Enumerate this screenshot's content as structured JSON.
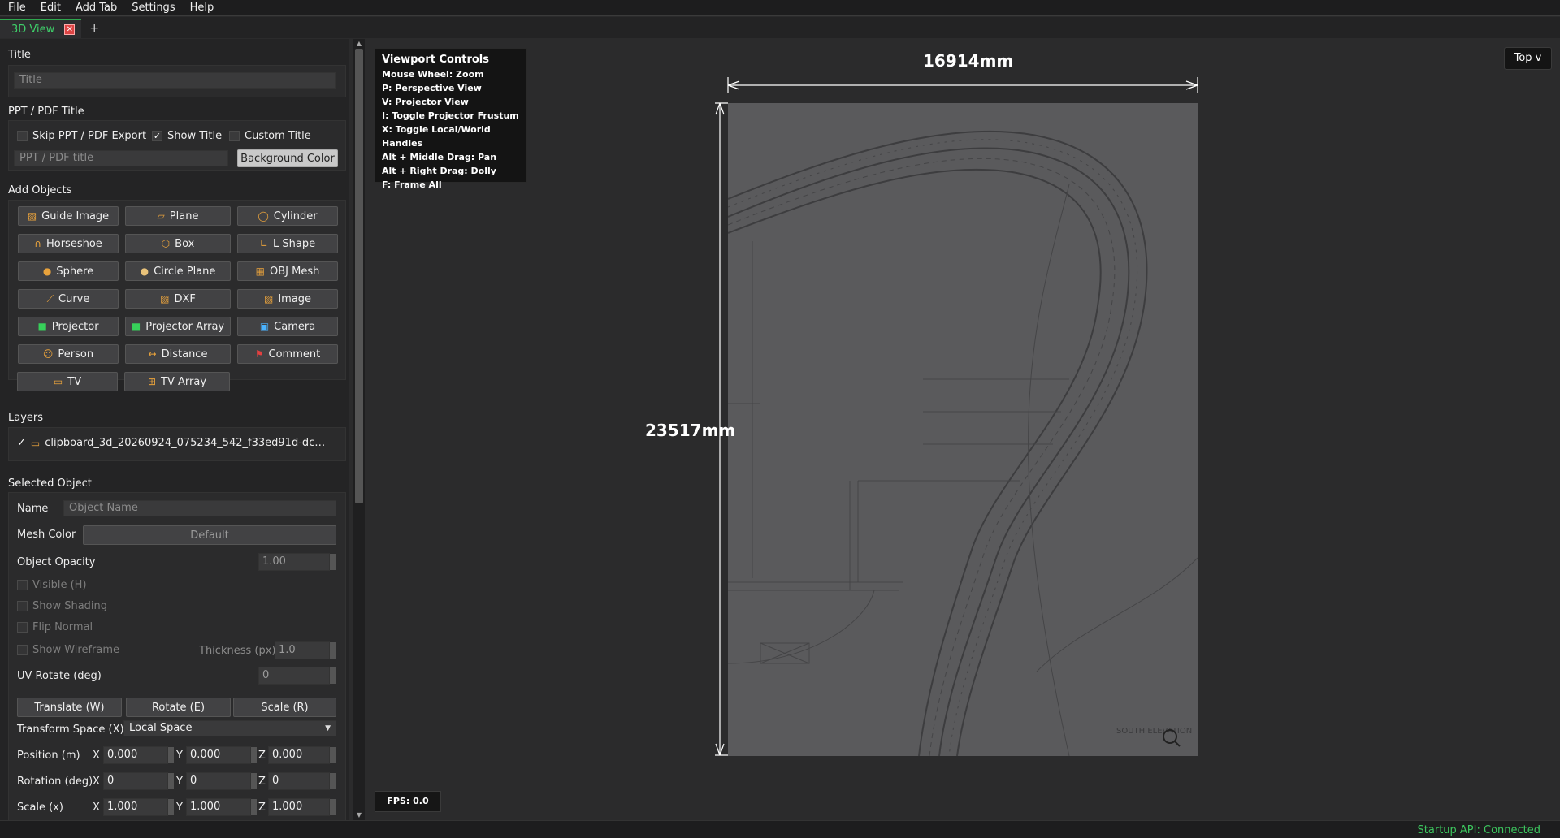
{
  "menu": [
    "File",
    "Edit",
    "Add Tab",
    "Settings",
    "Help"
  ],
  "tabs": {
    "active": "3D View",
    "close": "✕",
    "add": "+"
  },
  "left": {
    "title_section": {
      "heading": "Title",
      "placeholder": "Title"
    },
    "ppt": {
      "heading": "PPT / PDF Title",
      "skip": "Skip PPT / PDF Export",
      "show_title": "Show Title",
      "custom_title": "Custom Title",
      "placeholder": "PPT / PDF title",
      "bg_button": "Background Color"
    },
    "add_objects": {
      "heading": "Add Objects",
      "buttons": [
        "Guide Image",
        "Plane",
        "Cylinder",
        "Horseshoe",
        "Box",
        "L Shape",
        "Sphere",
        "Circle Plane",
        "OBJ Mesh",
        "Curve",
        "DXF",
        "Image",
        "Projector",
        "Projector Array",
        "Camera",
        "Person",
        "Distance",
        "Comment",
        "TV",
        "TV Array"
      ]
    },
    "layers": {
      "heading": "Layers",
      "item": "clipboard_3d_20260924_075234_542_f33ed91d-dc…"
    },
    "selected": {
      "heading": "Selected Object",
      "name_label": "Name",
      "name_placeholder": "Object Name",
      "mesh_color_label": "Mesh Color",
      "mesh_color_value": "Default",
      "opacity_label": "Object Opacity",
      "opacity_value": "1.00",
      "visible": "Visible (H)",
      "shading": "Show Shading",
      "flip": "Flip Normal",
      "wireframe": "Show Wireframe",
      "thickness_label": "Thickness (px)",
      "thickness_value": "1.0",
      "uv_label": "UV Rotate (deg)",
      "uv_value": "0",
      "translate": "Translate (W)",
      "rotate": "Rotate (E)",
      "scale": "Scale (R)",
      "transform_label": "Transform Space (X)",
      "transform_value": "Local Space",
      "position_label": "Position (m)",
      "rotation_label": "Rotation (deg)",
      "scale_label": "Scale (x)",
      "axis_x": "X",
      "axis_y": "Y",
      "axis_z": "Z",
      "position": [
        "0.000",
        "0.000",
        "0.000"
      ],
      "rotation": [
        "0",
        "0",
        "0"
      ],
      "scale_vals": [
        "1.000",
        "1.000",
        "1.000"
      ]
    }
  },
  "viewport": {
    "controls_title": "Viewport Controls",
    "controls": [
      "Mouse Wheel: Zoom",
      "P: Perspective View",
      "V: Projector View",
      "I: Toggle Projector Frustum",
      "X: Toggle Local/World Handles",
      "Alt + Middle Drag: Pan",
      "Alt + Right Drag: Dolly",
      "F: Frame All"
    ],
    "view_button": "Top v",
    "fps": "FPS: 0.0",
    "width_dim": "16914mm",
    "height_dim": "23517mm",
    "drawing_text": [
      "SOUTH ELEVATION"
    ]
  },
  "status": "Startup API: Connected"
}
